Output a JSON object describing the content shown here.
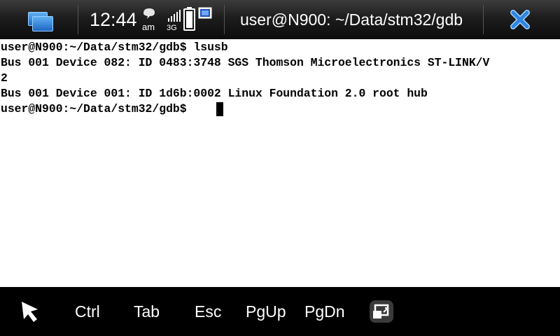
{
  "status_bar": {
    "time": "12:44",
    "ampm": "am",
    "network_type": "3G",
    "window_title": "user@N900: ~/Data/stm32/gdb"
  },
  "terminal": {
    "lines": [
      "user@N900:~/Data/stm32/gdb$ lsusb",
      "Bus 001 Device 082: ID 0483:3748 SGS Thomson Microelectronics ST-LINK/V",
      "2",
      "Bus 001 Device 001: ID 1d6b:0002 Linux Foundation 2.0 root hub",
      "user@N900:~/Data/stm32/gdb$ "
    ]
  },
  "toolbar": {
    "keys": [
      "Ctrl",
      "Tab",
      "Esc",
      "PgUp",
      "PgDn"
    ]
  },
  "icons": {
    "task_switcher": "task-switcher-icon",
    "presence": "presence-icon",
    "signal": "signal-strength-icon",
    "battery": "battery-icon",
    "usb": "usb-connection-icon",
    "close": "close-icon",
    "pointer": "pointer-arrow-icon",
    "fullscreen": "fullscreen-toggle-icon"
  },
  "colors": {
    "task_switcher_blue": "#1f66c4",
    "close_blue": "#2f84e0",
    "terminal_bg": "#ffffff",
    "terminal_text": "#000000"
  }
}
